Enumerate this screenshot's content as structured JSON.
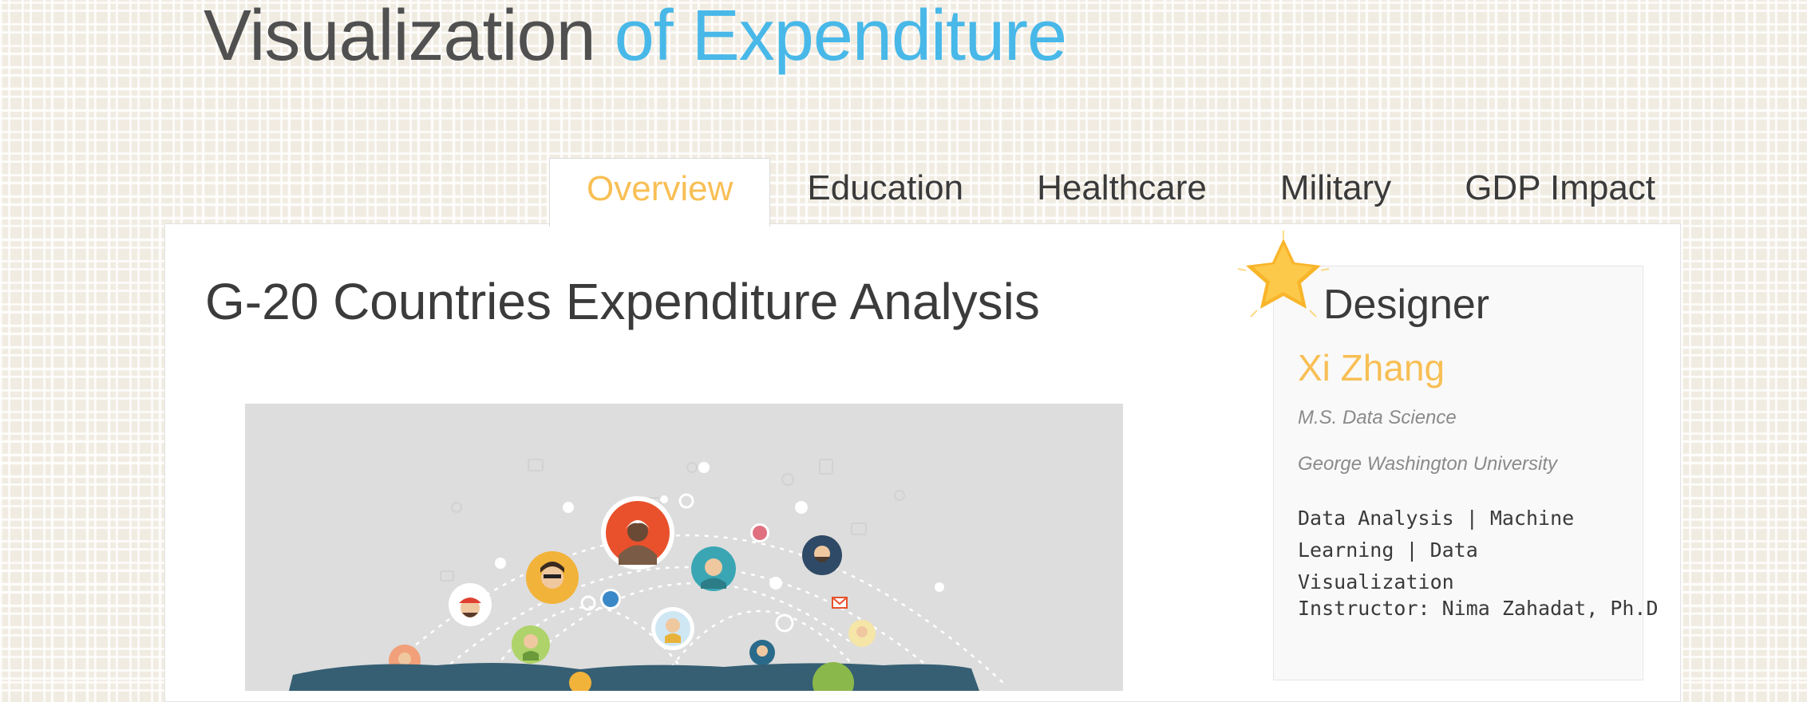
{
  "header": {
    "title_part1": "Visualization",
    "title_part2": "of Expenditure"
  },
  "tabs": [
    {
      "label": "Overview",
      "active": true
    },
    {
      "label": "Education",
      "active": false
    },
    {
      "label": "Healthcare",
      "active": false
    },
    {
      "label": "Military",
      "active": false
    },
    {
      "label": "GDP Impact",
      "active": false
    }
  ],
  "main": {
    "heading": "G-20 Countries Expenditure Analysis",
    "hero_icon": "global-network-people-illustration"
  },
  "designer": {
    "heading": "Designer",
    "name": "Xi Zhang",
    "degree": "M.S. Data Science",
    "school": "George Washington University",
    "skills": "Data Analysis | Machine Learning | Data Visualization",
    "instructor": "Instructor: Nima Zahadat, Ph.D",
    "icon": "star-icon"
  },
  "colors": {
    "accent_orange": "#f8bf55",
    "accent_blue": "#48b8e8",
    "text_dark": "#3b3b3b"
  }
}
